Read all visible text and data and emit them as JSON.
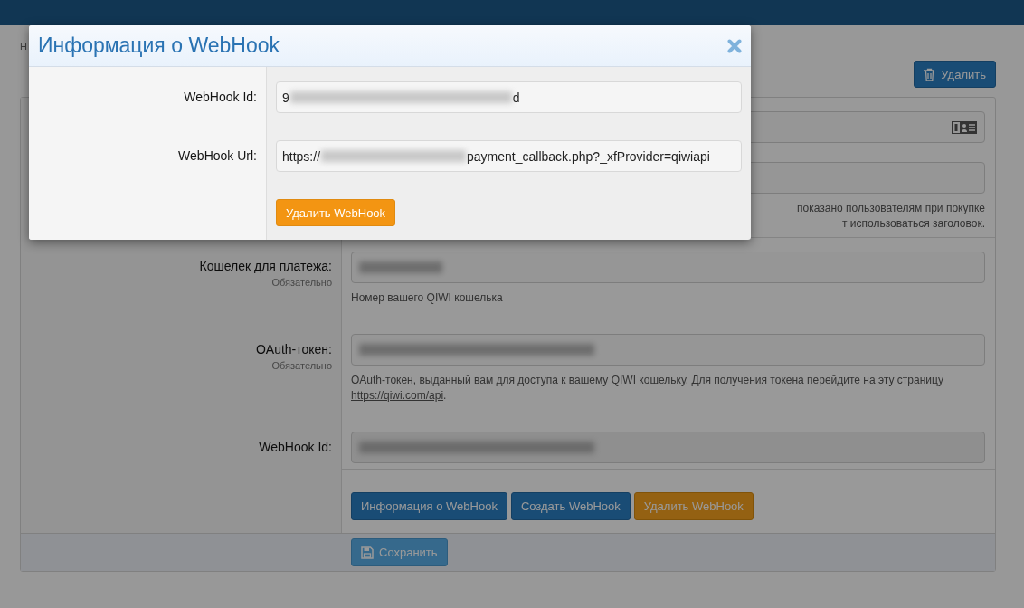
{
  "page": {
    "breadcrumb": "Н",
    "delete_button": "Удалить"
  },
  "form": {
    "rows": [
      {
        "kind": "card_input",
        "separated": false,
        "blurred": false
      },
      {
        "kind": "input",
        "separated": false,
        "blurred": false,
        "hint_lines": [
          "показано пользователям при покупке",
          "т использоваться заголовок."
        ]
      },
      {
        "kind": "input",
        "separated": true,
        "label": "Кошелек для платежа:",
        "required": "Обязательно",
        "blurred": true,
        "hint": "Номер вашего QIWI кошелька"
      },
      {
        "kind": "input",
        "separated": false,
        "label": "OAuth-токен:",
        "required": "Обязательно",
        "blurred": true,
        "hint": "OAuth-токен, выданный вам для доступа к вашему QIWI кошельку. Для получения токена перейдите на эту страницу",
        "link": "https://qiwi.com/api",
        "hint_end": "."
      },
      {
        "kind": "disabled_input",
        "separated": false,
        "label": "WebHook Id:",
        "blurred": true
      },
      {
        "kind": "buttons",
        "separated": true,
        "buttons": [
          {
            "label": "Информация о WebHook",
            "kind": "primary"
          },
          {
            "label": "Создать WebHook",
            "kind": "primary"
          },
          {
            "label": "Удалить WebHook",
            "kind": "warning"
          }
        ]
      }
    ],
    "save_button": "Сохранить"
  },
  "modal": {
    "title": "Информация о WebHook",
    "fields": [
      {
        "label": "WebHook Id:",
        "value_start": "9",
        "value_end": "d"
      },
      {
        "label": "WebHook Url:",
        "value_start": "https://",
        "value_end": "payment_callback.php?_xfProvider=qiwiapi"
      }
    ],
    "button": "Удалить WebHook"
  }
}
